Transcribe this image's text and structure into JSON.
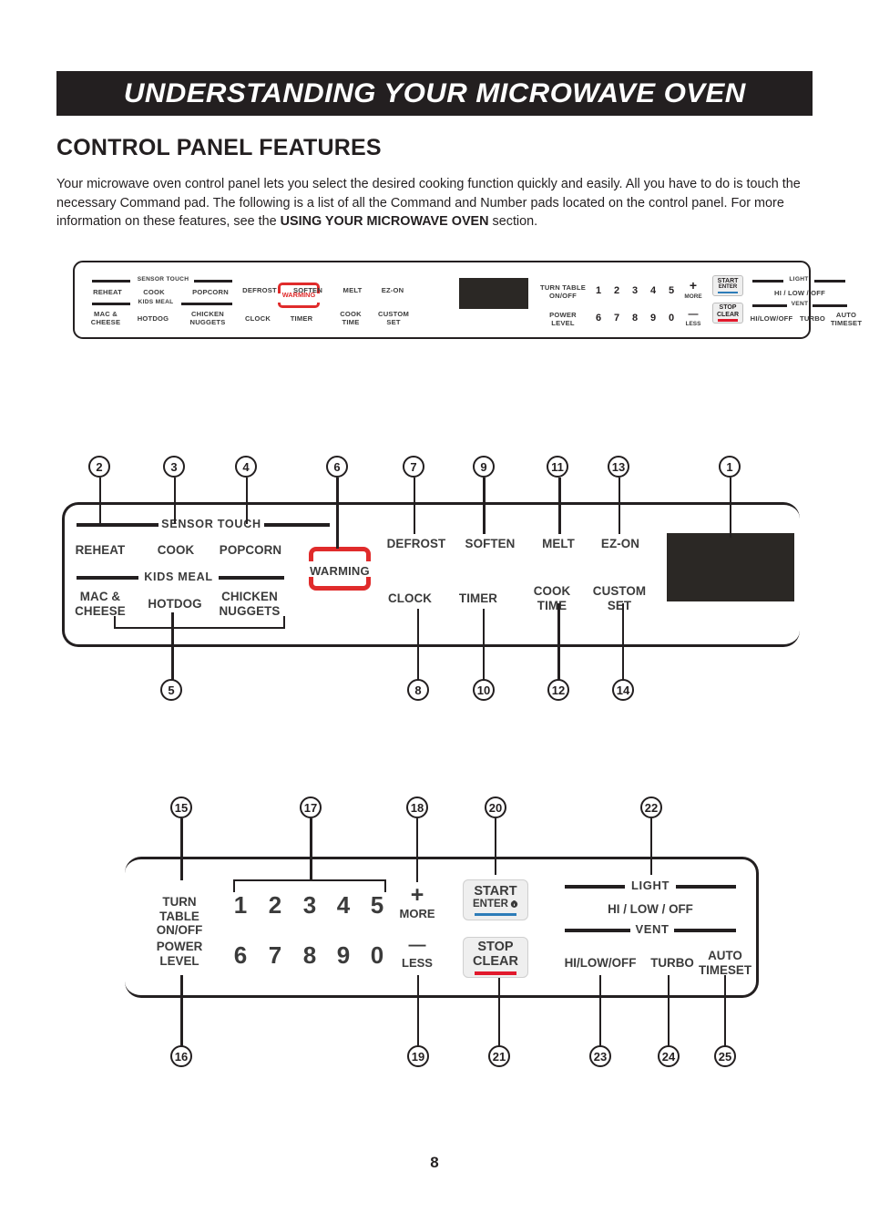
{
  "banner": {
    "title": "UNDERSTANDING YOUR MICROWAVE OVEN"
  },
  "section": {
    "title": "CONTROL PANEL FEATURES"
  },
  "intro": {
    "part1": "Your microwave oven control panel lets you select the desired cooking function quickly and easily. All you have to do is touch the necessary Command pad. The following is a list of all the Command and Number pads located on the control panel. For more information on these features, see the ",
    "bold": "USING YOUR MICROWAVE OVEN",
    "part2": " section."
  },
  "panel": {
    "group_labels": {
      "sensor_touch": "SENSOR TOUCH",
      "kids_meal": "KIDS MEAL",
      "light": "LIGHT",
      "vent": "VENT"
    },
    "sensor_touch": [
      "REHEAT",
      "COOK",
      "POPCORN"
    ],
    "kids_meal": [
      "MAC &\nCHEESE",
      "HOTDOG",
      "CHICKEN\nNUGGETS"
    ],
    "warming": "WARMING",
    "commands_row1": [
      "DEFROST",
      "SOFTEN",
      "MELT",
      "EZ-ON"
    ],
    "commands_row2": [
      "CLOCK",
      "TIMER",
      "COOK\nTIME",
      "CUSTOM\nSET"
    ],
    "turntable": "TURN TABLE\nON/OFF",
    "power_level": "POWER\nLEVEL",
    "numbers_row1": [
      "1",
      "2",
      "3",
      "4",
      "5"
    ],
    "numbers_row2": [
      "6",
      "7",
      "8",
      "9",
      "0"
    ],
    "more": {
      "glyph": "+",
      "word": "MORE"
    },
    "less": {
      "glyph": "—",
      "word": "LESS"
    },
    "start_button": {
      "line1": "START",
      "line2": "ENTER",
      "icon": "lock-icon",
      "accent": "#2d7cb8"
    },
    "stop_button": {
      "line1": "STOP",
      "line2": "CLEAR",
      "accent": "#e1192c"
    },
    "light_options": "HI / LOW / OFF",
    "vent_options": [
      "HI/LOW/OFF",
      "TURBO",
      "AUTO\nTIMESET"
    ]
  },
  "callouts": {
    "c1": "1",
    "c2": "2",
    "c3": "3",
    "c4": "4",
    "c5": "5",
    "c6": "6",
    "c7": "7",
    "c8": "8",
    "c9": "9",
    "c10": "10",
    "c11": "11",
    "c12": "12",
    "c13": "13",
    "c14": "14",
    "c15": "15",
    "c16": "16",
    "c17": "17",
    "c18": "18",
    "c19": "19",
    "c20": "20",
    "c21": "21",
    "c22": "22",
    "c23": "23",
    "c24": "24",
    "c25": "25"
  },
  "footer": {
    "page_number": "8"
  },
  "colors": {
    "ink": "#231f20",
    "warming_red": "#e02b2b",
    "start_blue": "#2d7cb8",
    "stop_red": "#e1192c",
    "display": "#2b2825"
  }
}
